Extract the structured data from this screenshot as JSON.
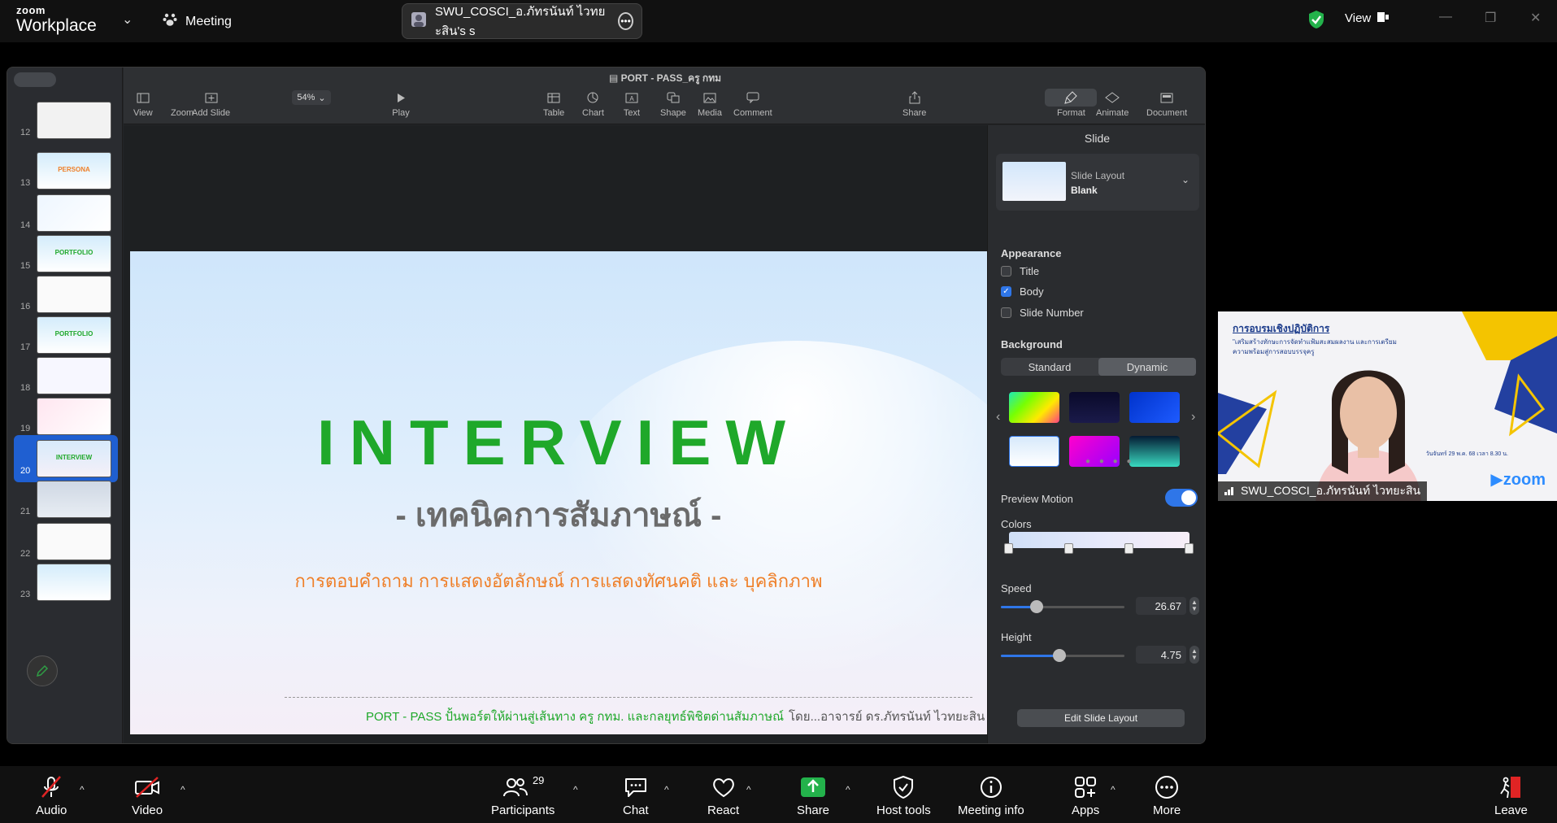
{
  "zoom": {
    "logo_top": "zoom",
    "logo_bottom": "Workplace",
    "meeting_label": "Meeting",
    "share_title": "SWU_COSCI_อ.ภัทรนันท์ ไวทยะสิน's s",
    "view_label": "View",
    "bottom": {
      "audio": "Audio",
      "video": "Video",
      "participants": "Participants",
      "participants_count": "29",
      "chat": "Chat",
      "react": "React",
      "share": "Share",
      "host_tools": "Host tools",
      "meeting_info": "Meeting info",
      "apps": "Apps",
      "more": "More",
      "leave": "Leave"
    },
    "camera": {
      "banner_title": "การอบรมเชิงปฏิบัติการ",
      "banner_sub": "\"เสริมสร้างทักษะการจัดทำแฟ้มสะสมผลงาน และการเตรียมความพร้อมสู่การสอบบรรจุครู",
      "name": "SWU_COSCI_อ.ภัทรนันท์ ไวทยะสิน",
      "date_text": "วันจันทร์ 29 พ.ค. 68 เวลา 8.30 น.",
      "brand": "zoom"
    }
  },
  "keynote": {
    "doc_title": "PORT - PASS_ครู กทม",
    "zoom_value": "54%",
    "toolbar": {
      "view": "View",
      "zoom": "Zoom",
      "add_slide": "Add Slide",
      "play": "Play",
      "table": "Table",
      "chart": "Chart",
      "text": "Text",
      "shape": "Shape",
      "media": "Media",
      "comment": "Comment",
      "share": "Share",
      "format": "Format",
      "animate": "Animate",
      "document": "Document"
    },
    "slides": [
      {
        "num": "12",
        "label": ""
      },
      {
        "num": "13",
        "label": "PERSONA"
      },
      {
        "num": "14",
        "label": ""
      },
      {
        "num": "15",
        "label": "PORTFOLIO"
      },
      {
        "num": "16",
        "label": ""
      },
      {
        "num": "17",
        "label": "PORTFOLIO"
      },
      {
        "num": "18",
        "label": ""
      },
      {
        "num": "19",
        "label": ""
      },
      {
        "num": "20",
        "label": "INTERVIEW"
      },
      {
        "num": "21",
        "label": ""
      },
      {
        "num": "22",
        "label": ""
      },
      {
        "num": "23",
        "label": ""
      }
    ],
    "slide": {
      "title": "INTERVIEW",
      "subtitle": "- เทคนิคการสัมภาษณ์ -",
      "subtitle2": "การตอบคำถาม การแสดงอัตลักษณ์ การแสดงทัศนคติ และ บุคลิกภาพ",
      "footer_left": "PORT - PASS ปั้นพอร์ตให้ผ่านสู่เส้นทาง ครู กทม. และกลยุทธ์พิชิตด่านสัมภาษณ์",
      "footer_right": "โดย...อาจารย์ ดร.ภัทรนันท์ ไวทยะสิน"
    },
    "inspector": {
      "title": "Slide",
      "layout_label": "Slide Layout",
      "layout_value": "Blank",
      "appearance": "Appearance",
      "opt_title": "Title",
      "opt_body": "Body",
      "opt_slide_number": "Slide Number",
      "background": "Background",
      "bg_standard": "Standard",
      "bg_dynamic": "Dynamic",
      "preview_motion": "Preview Motion",
      "colors": "Colors",
      "speed": "Speed",
      "speed_value": "26.67",
      "height": "Height",
      "height_value": "4.75",
      "edit_layout": "Edit Slide Layout"
    }
  }
}
